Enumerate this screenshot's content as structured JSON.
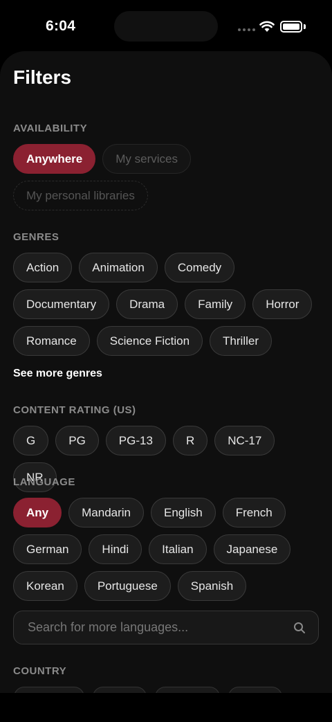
{
  "status": {
    "time": "6:04"
  },
  "title": "Filters",
  "availability": {
    "label": "AVAILABILITY",
    "options": [
      "Anywhere",
      "My services",
      "My personal libraries"
    ]
  },
  "genres": {
    "label": "GENRES",
    "options": [
      "Action",
      "Animation",
      "Comedy",
      "Documentary",
      "Drama",
      "Family",
      "Horror",
      "Romance",
      "Science Fiction",
      "Thriller"
    ],
    "see_more": "See more genres"
  },
  "content_rating": {
    "label": "CONTENT RATING (US)",
    "options": [
      "G",
      "PG",
      "PG-13",
      "R",
      "NC-17",
      "NR"
    ]
  },
  "language": {
    "label": "LANGUAGE",
    "options": [
      "Any",
      "Mandarin",
      "English",
      "French",
      "German",
      "Hindi",
      "Italian",
      "Japanese",
      "Korean",
      "Portuguese",
      "Spanish"
    ],
    "search_placeholder": "Search for more languages..."
  },
  "country": {
    "label": "COUNTRY"
  },
  "colors": {
    "accent": "#8b2131",
    "background": "#0f0f0f",
    "chip": "#1d1d1d"
  }
}
